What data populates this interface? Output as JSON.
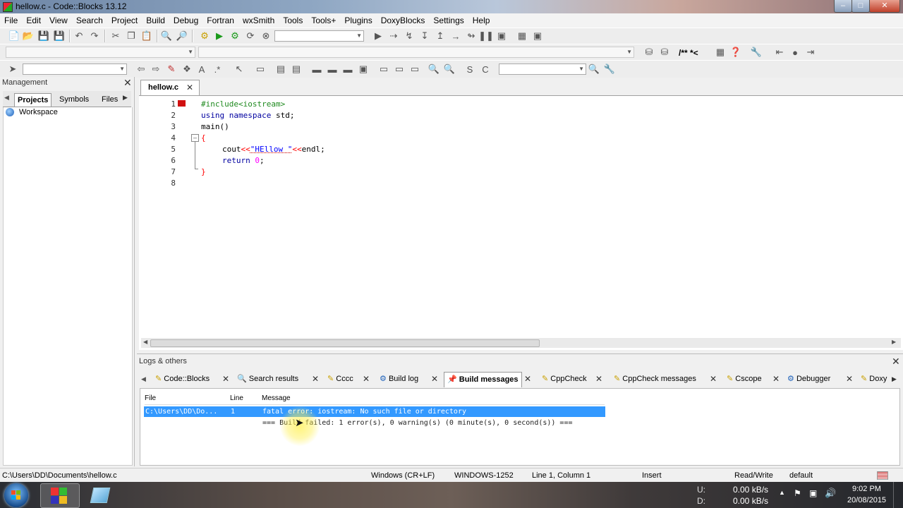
{
  "window": {
    "title": "hellow.c - Code::Blocks 13.12"
  },
  "menu": [
    "File",
    "Edit",
    "View",
    "Search",
    "Project",
    "Build",
    "Debug",
    "Fortran",
    "wxSmith",
    "Tools",
    "Tools+",
    "Plugins",
    "DoxyBlocks",
    "Settings",
    "Help"
  ],
  "toolbar": {
    "compiler_comment": "/** *<"
  },
  "management": {
    "title": "Management",
    "tabs": [
      "Projects",
      "Symbols",
      "Files"
    ],
    "active_tab": "Projects",
    "tree": [
      "Workspace"
    ]
  },
  "editor": {
    "tab_label": "hellow.c",
    "lines": [
      "1",
      "2",
      "3",
      "4",
      "5",
      "6",
      "7",
      "8"
    ],
    "code": {
      "l1": "#include<iostream>",
      "l2_kw1": "using",
      "l2_kw2": "namespace",
      "l2_rest": " std;",
      "l3": "main()",
      "l4": "{",
      "l5_a": "cout",
      "l5_op": "<<",
      "l5_str": "\"HEllow \"",
      "l5_op2": "<<",
      "l5_b": "endl;",
      "l6_kw": "return",
      "l6_num": "0",
      "l6_end": ";",
      "l7": "}"
    }
  },
  "logs": {
    "title": "Logs & others",
    "tabs": [
      {
        "label": "Code::Blocks"
      },
      {
        "label": "Search results"
      },
      {
        "label": "Cccc"
      },
      {
        "label": "Build log"
      },
      {
        "label": "Build messages"
      },
      {
        "label": "CppCheck"
      },
      {
        "label": "CppCheck messages"
      },
      {
        "label": "Cscope"
      },
      {
        "label": "Debugger"
      },
      {
        "label": "Doxy"
      }
    ],
    "active_tab": "Build messages",
    "columns": {
      "file": "File",
      "line": "Line",
      "message": "Message"
    },
    "rows": [
      {
        "file": "C:\\Users\\DD\\Do...",
        "line": "1",
        "message": "fatal error: iostream: No such file or directory"
      },
      {
        "file": "",
        "line": "",
        "message": "=== Build failed: 1 error(s), 0 warning(s) (0 minute(s), 0 second(s)) ==="
      }
    ]
  },
  "status": {
    "path": "C:\\Users\\DD\\Documents\\hellow.c",
    "eol": "Windows (CR+LF)",
    "encoding": "WINDOWS-1252",
    "position": "Line 1, Column 1",
    "mode": "Insert",
    "access": "Read/Write",
    "keymap": "default"
  },
  "taskbar": {
    "up_label": "U:",
    "up_rate": "0.00 kB/s",
    "down_label": "D:",
    "down_rate": "0.00 kB/s",
    "time": "9:02 PM",
    "date": "20/08/2015"
  }
}
